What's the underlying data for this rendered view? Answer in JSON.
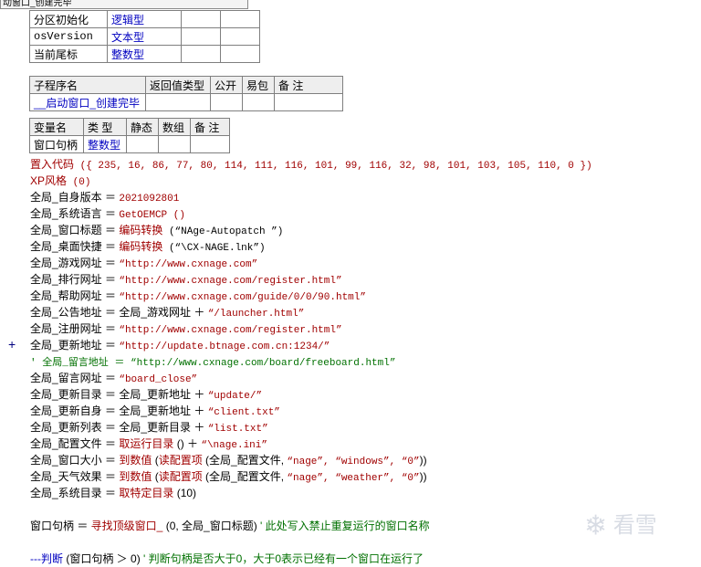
{
  "tab_title": "动窗口_创建完毕",
  "table1": {
    "rows": [
      {
        "name": "分区初始化",
        "type": "逻辑型"
      },
      {
        "name": "osVersion",
        "type": "文本型"
      },
      {
        "name": "当前尾标",
        "type": "整数型"
      }
    ]
  },
  "sub_table": {
    "headers": [
      "子程序名",
      "返回值类型",
      "公开",
      "易包",
      "备 注"
    ],
    "name": "__启动窗口_创建完毕"
  },
  "var_table": {
    "headers": [
      "变量名",
      "类 型",
      "静态",
      "数组",
      "备 注"
    ],
    "row": {
      "name": "窗口句柄",
      "type": "整数型"
    }
  },
  "code": {
    "l1_cmd": "置入代码",
    "l1_args": " ({ 235, 16, 86, 77, 80, 114, 111, 116, 101, 99, 116, 32, 98, 101, 103, 105, 110, 0 })",
    "l2_cmd": "XP风格",
    "l2_args": " (0)",
    "l3_var": "全局_自身版本 ＝ ",
    "l3_val": "2021092801",
    "l4_var": "全局_系统语言 ＝ ",
    "l4_val": "GetOEMCP ()",
    "l5_var": "全局_窗口标题 ＝ ",
    "l5_cmd": "编码转换",
    "l5_args": " (“NAge-Autopatch ”)",
    "l6_var": "全局_桌面快捷 ＝ ",
    "l6_cmd": "编码转换",
    "l6_args": " (“\\CX-NAGE.lnk”)",
    "l7_var": "全局_游戏网址 ＝ ",
    "l7_val": "“http://www.cxnage.com”",
    "l8_var": "全局_排行网址 ＝ ",
    "l8_val": "“http://www.cxnage.com/register.html”",
    "l9_var": "全局_帮助网址 ＝ ",
    "l9_val": "“http://www.cxnage.com/guide/0/0/90.html”",
    "l10_var": "全局_公告地址 ＝ 全局_游戏网址 ＋ ",
    "l10_val": "“/launcher.html”",
    "l11_var": "全局_注册网址 ＝ ",
    "l11_val": "“http://www.cxnage.com/register.html”",
    "l12_var": "全局_更新地址 ＝ ",
    "l12_val": "“http://update.btnage.com.cn:1234/”",
    "l13_comment": "' 全局_留言地址 ＝ “http://www.cxnage.com/board/freeboard.html”",
    "l14_var": "全局_留言网址 ＝ ",
    "l14_val": "“board_close”",
    "l15_var": "全局_更新目录 ＝ 全局_更新地址 ＋ ",
    "l15_val": "“update/”",
    "l16_var": "全局_更新自身 ＝ 全局_更新地址 ＋ ",
    "l16_val": "“client.txt”",
    "l17_var": "全局_更新列表 ＝ 全局_更新目录 ＋ ",
    "l17_val": "“list.txt”",
    "l18_var": "全局_配置文件 ＝ ",
    "l18_cmd": "取运行目录",
    "l18_mid": " () ＋ ",
    "l18_val": "“\\nage.ini”",
    "l19_var": "全局_窗口大小 ＝ ",
    "l19_cmd": "到数值",
    "l19_open": " (",
    "l19_cmd2": "读配置项",
    "l19_args": " (全局_配置文件, ",
    "l19_val": "“nage”, “windows”, “0”",
    "l19_close": "))",
    "l20_var": "全局_天气效果 ＝ ",
    "l20_cmd": "到数值",
    "l20_open": " (",
    "l20_cmd2": "读配置项",
    "l20_args": " (全局_配置文件, ",
    "l20_val": "“nage”, “weather”, “0”",
    "l20_close": "))",
    "l21_var": "全局_系统目录 ＝ ",
    "l21_cmd": "取特定目录",
    "l21_args": " (10)",
    "l22_var": "窗口句柄 ＝ ",
    "l22_cmd": "寻找顶级窗口_",
    "l22_args": " (0, 全局_窗口标题) ",
    "l22_comment": "' 此处写入禁止重复运行的窗口名称",
    "l23_prefix": "---",
    "l23_cmd": "判断",
    "l23_args": " (窗口句柄 ＞ 0) ",
    "l23_comment": "' 判断句柄是否大于0，大于0表示已经有一个窗口在运行了"
  },
  "gutter_marker": "+",
  "watermark_text": "看雪",
  "colors": {
    "keyword": "#a00000",
    "comment": "#007000",
    "type_value": "#0000c0"
  }
}
